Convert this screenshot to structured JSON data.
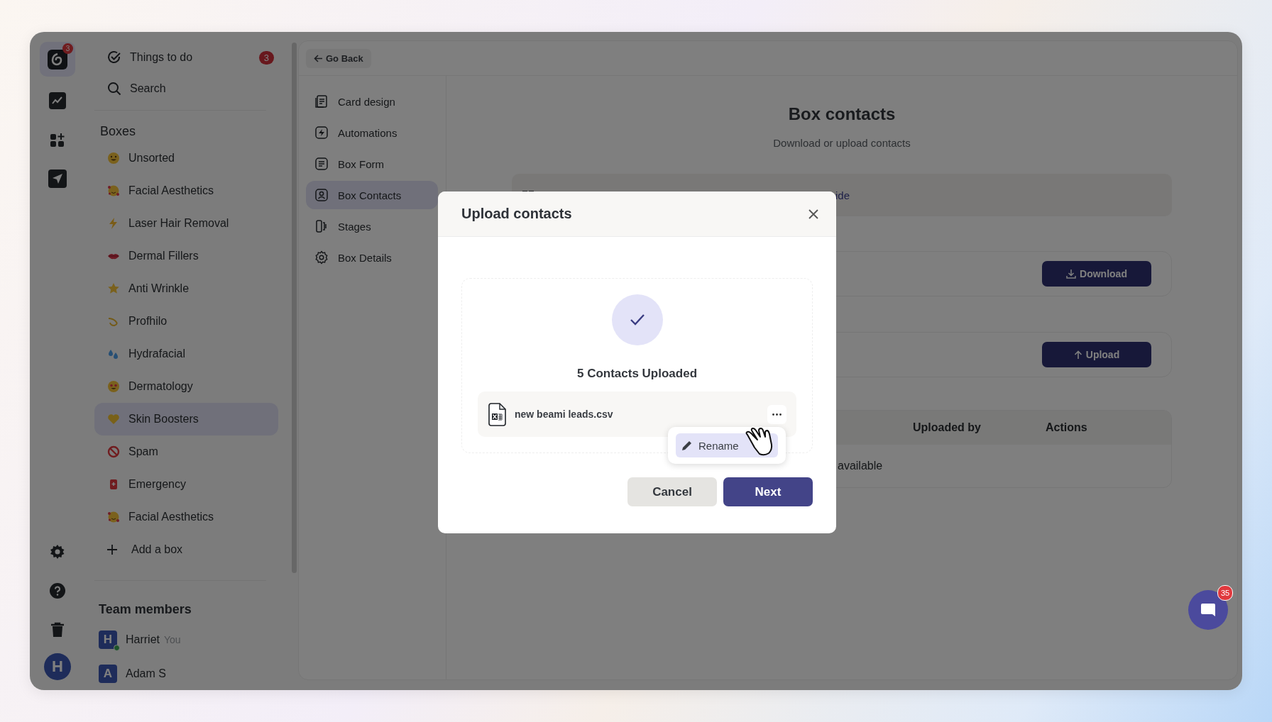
{
  "rail": {
    "logo_badge": "3",
    "avatar": "H"
  },
  "sidebar": {
    "things_to_do": {
      "label": "Things to do",
      "badge": "3"
    },
    "search": {
      "label": "Search"
    },
    "boxes_heading": "Boxes",
    "boxes": [
      {
        "label": "Unsorted",
        "selected": false
      },
      {
        "label": "Facial Aesthetics",
        "selected": false
      },
      {
        "label": "Laser Hair Removal",
        "selected": false
      },
      {
        "label": "Dermal Fillers",
        "selected": false
      },
      {
        "label": "Anti Wrinkle",
        "selected": false
      },
      {
        "label": "Profhilo",
        "selected": false
      },
      {
        "label": "Hydrafacial",
        "selected": false
      },
      {
        "label": "Dermatology",
        "selected": false
      },
      {
        "label": "Skin Boosters",
        "selected": true
      },
      {
        "label": "Spam",
        "selected": false
      },
      {
        "label": "Emergency",
        "selected": false
      },
      {
        "label": "Facial Aesthetics",
        "selected": false
      }
    ],
    "add_box": "Add a box",
    "team_heading": "Team members",
    "members": [
      {
        "initial": "H",
        "name": "Harriet",
        "tag": "You",
        "online": true
      },
      {
        "initial": "A",
        "name": "Adam S",
        "online": false
      }
    ]
  },
  "topbar": {
    "back": "Go Back"
  },
  "subnav": [
    {
      "label": "Card design",
      "selected": false
    },
    {
      "label": "Automations",
      "selected": false
    },
    {
      "label": "Box Form",
      "selected": false
    },
    {
      "label": "Box Contacts",
      "selected": true
    },
    {
      "label": "Stages",
      "selected": false
    },
    {
      "label": "Box Details",
      "selected": false
    }
  ],
  "content": {
    "title": "Box contacts",
    "subtitle": "Download or upload contacts",
    "banner_link": "ide",
    "download_button": "Download",
    "upload_button": "Upload",
    "table": {
      "columns": [
        "Uploaded by",
        "Actions"
      ],
      "empty_message": "available"
    }
  },
  "modal": {
    "title": "Upload contacts",
    "status": "5 Contacts Uploaded",
    "file_name": "new beami leads.csv",
    "menu": [
      {
        "label": "Rename",
        "highlighted": true
      }
    ],
    "buttons": [
      {
        "label": "Cancel",
        "kind": "secondary"
      },
      {
        "label": "Next",
        "kind": "primary"
      }
    ]
  },
  "chat": {
    "badge": "35"
  }
}
